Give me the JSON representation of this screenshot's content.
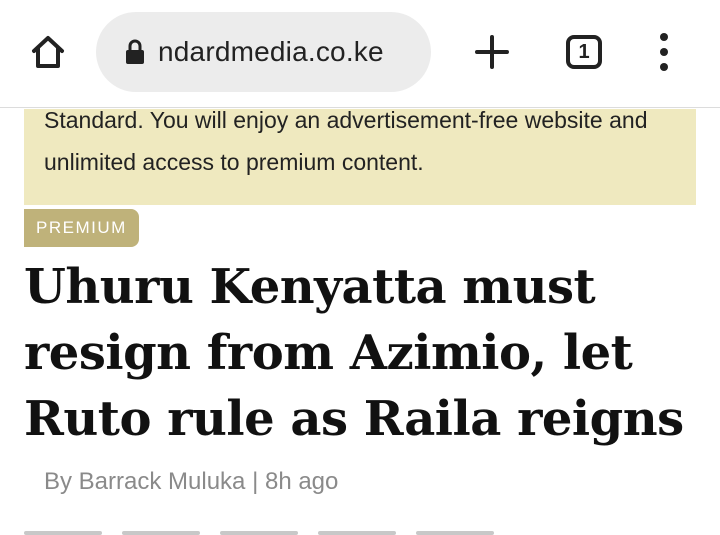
{
  "browser": {
    "url": "ndardmedia.co.ke",
    "tab_count": "1",
    "icons": {
      "home": "home-icon",
      "lock": "lock-icon",
      "new_tab": "plus-icon",
      "tabs": "tab-switcher-icon",
      "menu": "more-vert-icon"
    }
  },
  "notice": {
    "text": "Standard. You will enjoy an advertisement-free website and unlimited access to premium content."
  },
  "article": {
    "badge": "PREMIUM",
    "headline": "Uhuru Kenyatta must resign from Azimio, let Ruto rule as Raila reigns",
    "byline": "By Barrack Muluka | 8h ago"
  },
  "colors": {
    "notice_bg": "#efe9bf",
    "badge_bg": "#bfb27a",
    "url_bar_bg": "#ececec",
    "byline": "#8a8a8a"
  }
}
